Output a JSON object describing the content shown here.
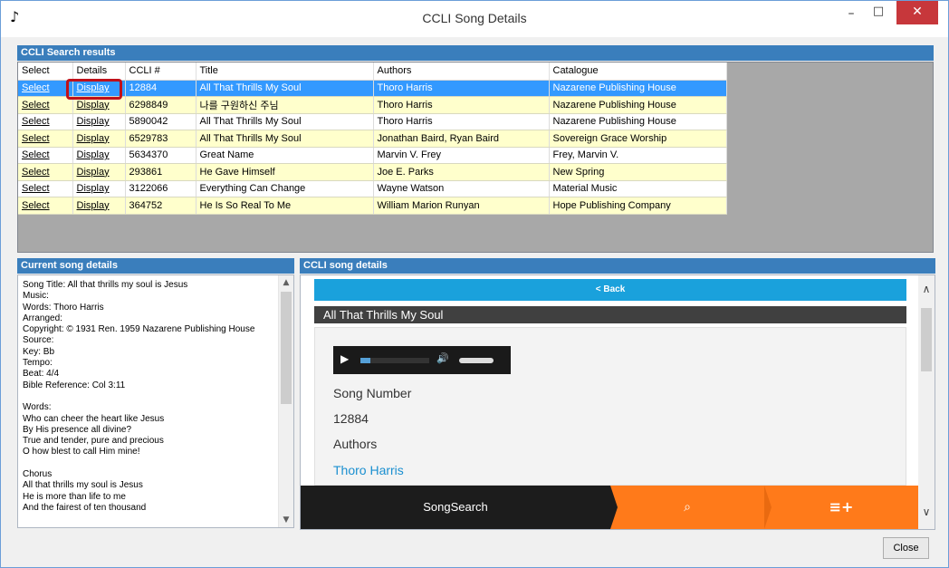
{
  "window": {
    "title": "CCLI Song Details",
    "icon_glyph": "♪",
    "minimize": "–",
    "maximize": "□",
    "close": "✕"
  },
  "search_results": {
    "header": "CCLI Search results",
    "columns": [
      "Select",
      "Details",
      "CCLI #",
      "Title",
      "Authors",
      "Catalogue"
    ],
    "rows": [
      {
        "select": "Select",
        "details": "Display",
        "ccli": "12884",
        "title": "All That Thrills My Soul",
        "authors": "Thoro Harris",
        "catalogue": "Nazarene Publishing House"
      },
      {
        "select": "Select",
        "details": "Display",
        "ccli": "6298849",
        "title": "나를 구원하신 주님",
        "authors": "Thoro Harris",
        "catalogue": "Nazarene Publishing House"
      },
      {
        "select": "Select",
        "details": "Display",
        "ccli": "5890042",
        "title": "All That Thrills My Soul",
        "authors": "Thoro Harris",
        "catalogue": "Nazarene Publishing House"
      },
      {
        "select": "Select",
        "details": "Display",
        "ccli": "6529783",
        "title": "All That Thrills My Soul",
        "authors": "Jonathan Baird, Ryan Baird",
        "catalogue": "Sovereign Grace Worship"
      },
      {
        "select": "Select",
        "details": "Display",
        "ccli": "5634370",
        "title": "Great Name",
        "authors": "Marvin V. Frey",
        "catalogue": "Frey, Marvin V."
      },
      {
        "select": "Select",
        "details": "Display",
        "ccli": "293861",
        "title": "He Gave Himself",
        "authors": "Joe E. Parks",
        "catalogue": "New Spring"
      },
      {
        "select": "Select",
        "details": "Display",
        "ccli": "3122066",
        "title": "Everything Can Change",
        "authors": "Wayne Watson",
        "catalogue": "Material Music"
      },
      {
        "select": "Select",
        "details": "Display",
        "ccli": "364752",
        "title": "He Is So Real To Me",
        "authors": "William Marion Runyan",
        "catalogue": "Hope Publishing Company"
      }
    ]
  },
  "current_song": {
    "header": "Current song details",
    "text": "Song Title: All that thrills my soul is Jesus\nMusic:\nWords: Thoro Harris\nArranged:\nCopyright: © 1931 Ren. 1959 Nazarene Publishing House\nSource:\nKey: Bb\nTempo:\nBeat: 4/4\nBible Reference: Col 3:11\n\nWords:\nWho can cheer the heart like Jesus\nBy His presence all divine?\nTrue and tender, pure and precious\nO how blest to call Him mine!\n\nChorus\nAll that thrills my soul is Jesus\nHe is more than life to me\nAnd the fairest of ten thousand"
  },
  "ccli_details": {
    "header": "CCLI song details",
    "back": "< Back",
    "song_title": "All That Thrills My Soul",
    "song_number_label": "Song Number",
    "song_number": "12884",
    "authors_label": "Authors",
    "author": "Thoro Harris",
    "nav_songsearch": "SongSearch",
    "nav_search_icon": "⌕",
    "nav_list_icon": "≡+",
    "player_progress": 0.14
  },
  "buttons": {
    "close": "Close"
  },
  "colors": {
    "group_header": "#3a7ebc",
    "selected_row": "#3399ff",
    "alt_row": "#ffffcc",
    "accent_orange": "#ff7a1a",
    "back_bar": "#1aa1dc",
    "highlight": "#c0101a"
  }
}
